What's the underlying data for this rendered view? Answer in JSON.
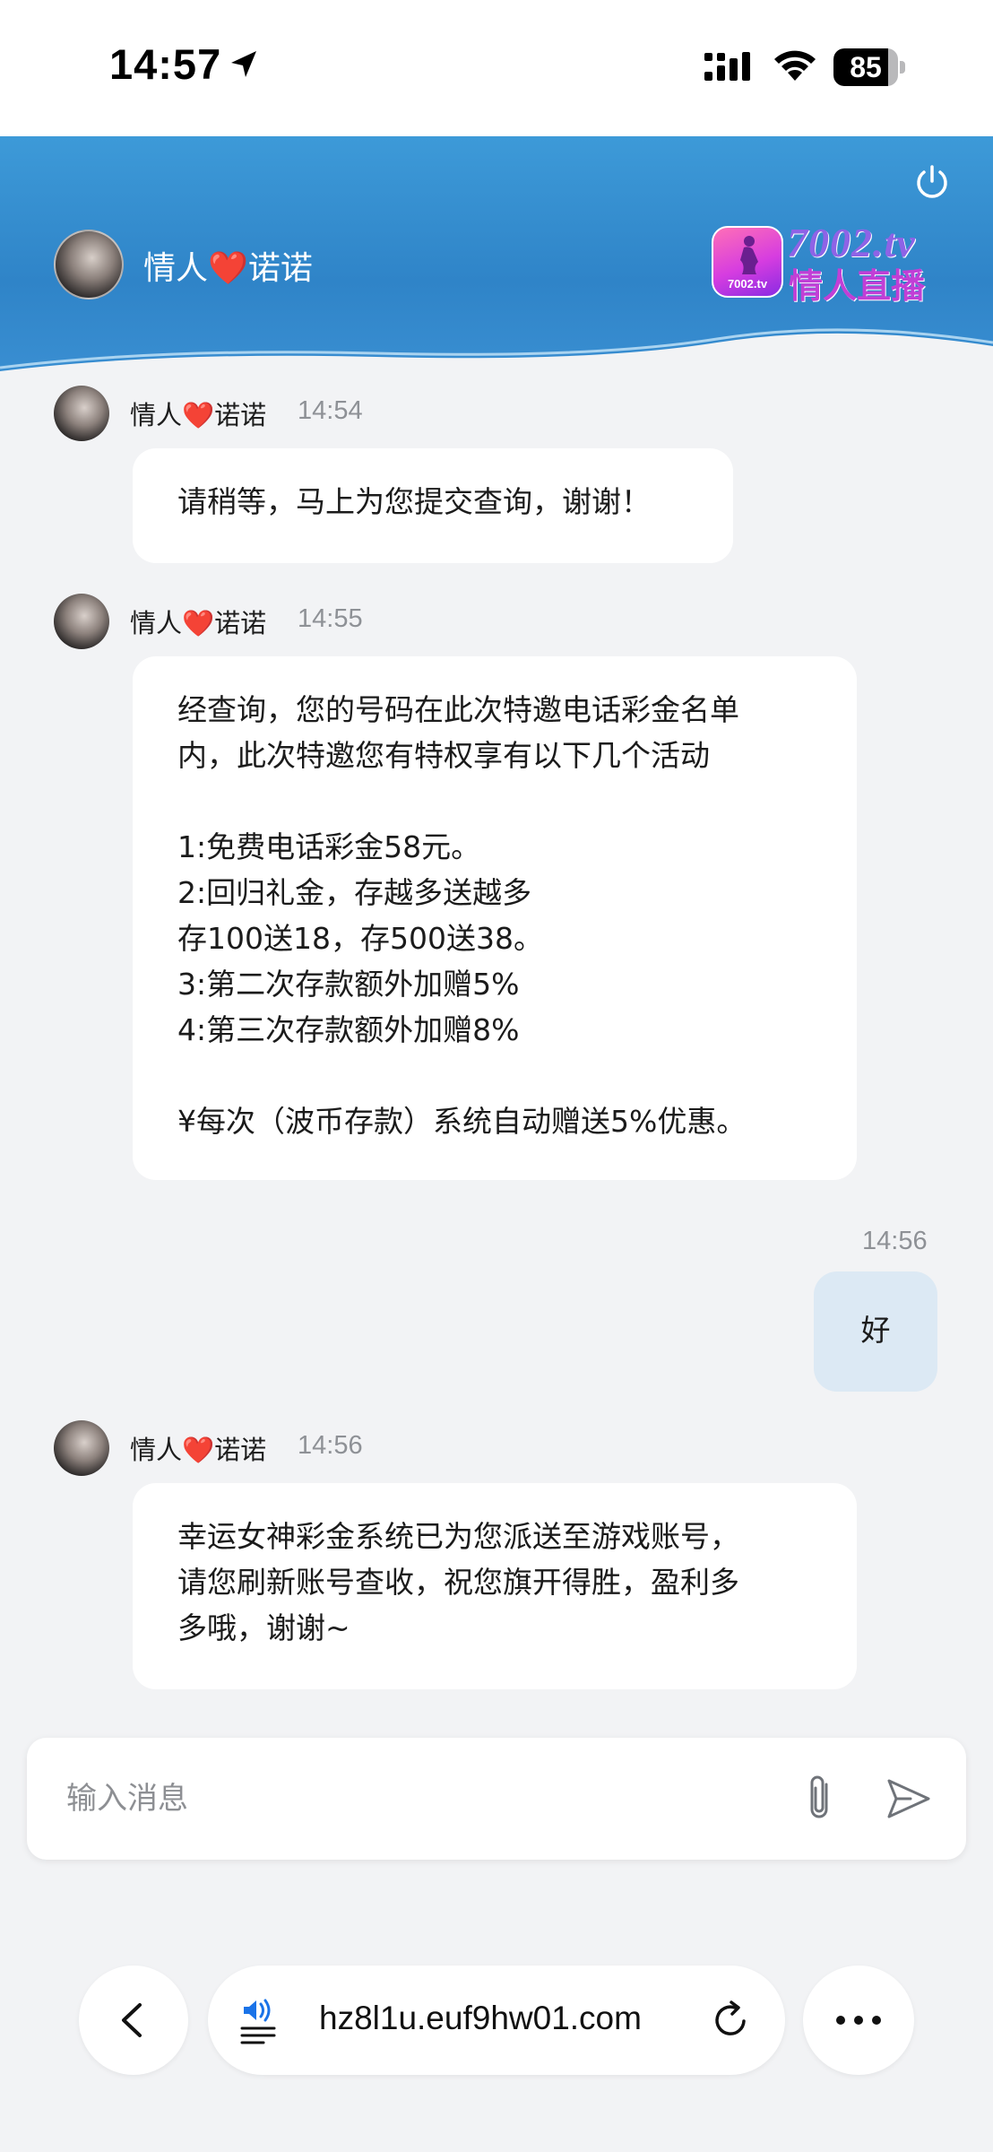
{
  "status_bar": {
    "time": "14:57",
    "battery": "85",
    "battery_level": 0.85,
    "icons": [
      "location-arrow-icon",
      "cellular-signal-icon",
      "wifi-icon",
      "battery-icon"
    ]
  },
  "header": {
    "contact_name_prefix": "情人",
    "contact_name_heart": "❤️",
    "contact_name_suffix": "诺诺",
    "brand_en": "7002.tv",
    "brand_cn": "情人直播",
    "brand_logo_text": "7002.tv",
    "icons": [
      "power-icon"
    ]
  },
  "messages": [
    {
      "sender_prefix": "情人",
      "sender_heart": "❤️",
      "sender_suffix": "诺诺",
      "time": "14:54",
      "text": "请稍等，马上为您提交查询，谢谢！"
    },
    {
      "sender_prefix": "情人",
      "sender_heart": "❤️",
      "sender_suffix": "诺诺",
      "time": "14:55",
      "text": "经查询，您的号码在此次特邀电话彩金名单\n内，此次特邀您有特权享有以下几个活动\n\n1:免费电话彩金58元。\n2:回归礼金，存越多送越多\n存100送18，存500送38。\n3:第二次存款额外加赠5%\n4:第三次存款额外加赠8%\n\n¥每次（波币存款）系统自动赠送5%优惠。"
    },
    {
      "self": true,
      "time": "14:56",
      "text": "好"
    },
    {
      "sender_prefix": "情人",
      "sender_heart": "❤️",
      "sender_suffix": "诺诺",
      "time": "14:56",
      "text": "幸运女神彩金系统已为您派送至游戏账号，\n请您刷新账号查收，祝您旗开得胜，盈利多\n多哦，谢谢~"
    }
  ],
  "composer": {
    "placeholder": "输入消息",
    "value": "",
    "icons": [
      "paperclip-icon",
      "send-icon"
    ]
  },
  "browser": {
    "url": "hz8l1u.euf9hw01.com",
    "icons": [
      "back-chevron-icon",
      "reader-audio-icon",
      "reload-icon",
      "more-dots-icon"
    ]
  }
}
